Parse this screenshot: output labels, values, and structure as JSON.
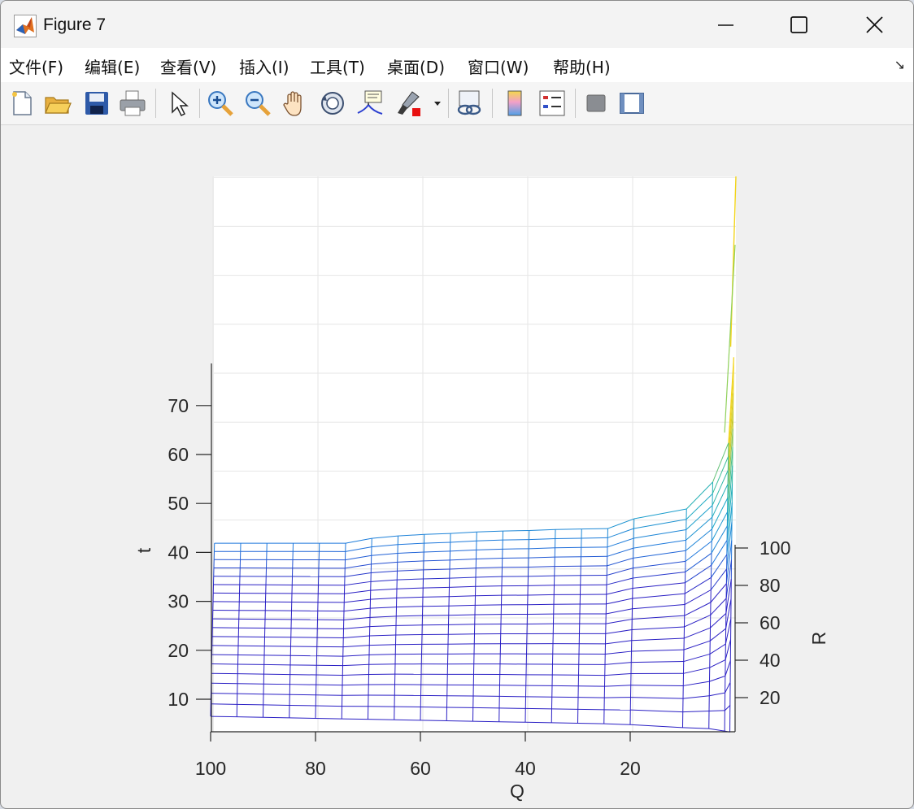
{
  "window": {
    "title": "Figure 7"
  },
  "menubar": {
    "items": [
      "文件(F)",
      "编辑(E)",
      "查看(V)",
      "插入(I)",
      "工具(T)",
      "桌面(D)",
      "窗口(W)",
      "帮助(H)"
    ],
    "dock_arrow": "↘"
  },
  "toolbar": {
    "icons": [
      "new-figure-icon",
      "open-file-icon",
      "save-icon",
      "print-icon",
      "edit-plot-arrow-icon",
      "zoom-in-icon",
      "zoom-out-icon",
      "pan-hand-icon",
      "rotate-3d-icon",
      "data-cursor-icon",
      "brush-icon",
      "brush-dropdown-icon",
      "link-plot-icon",
      "colorbar-icon",
      "legend-icon",
      "hide-plot-tools-icon",
      "show-plot-tools-icon"
    ]
  },
  "colors": {
    "mesh_low": "#2a1fc4",
    "mesh_mid": "#1aa8c8",
    "mesh_high": "#f2d41a",
    "grid": "#e6e6e6",
    "axis": "#262626"
  },
  "chart_data": {
    "type": "surface-mesh",
    "view": "3d",
    "colormap": "parula",
    "grid": true,
    "xlabel": "Q",
    "ylabel": "R",
    "zlabel": "t",
    "x_axis": {
      "label": "Q",
      "ticks": [
        100,
        80,
        60,
        40,
        20
      ],
      "range": [
        0,
        100
      ],
      "direction": "reversed"
    },
    "y_axis": {
      "label": "R",
      "ticks": [
        20,
        40,
        60,
        80,
        100
      ],
      "range": [
        0,
        110
      ]
    },
    "z_axis": {
      "label": "t",
      "ticks": [
        10,
        20,
        30,
        40,
        50,
        60,
        70
      ],
      "range": [
        3,
        80
      ]
    },
    "Q": [
      100,
      95,
      90,
      85,
      80,
      75,
      70,
      65,
      60,
      55,
      50,
      45,
      40,
      35,
      30,
      25,
      20,
      10,
      5,
      2,
      1
    ],
    "R": [
      5,
      10,
      15,
      20,
      25,
      30,
      35,
      40,
      45,
      50,
      55,
      60,
      65,
      70,
      75,
      80,
      85,
      90,
      95,
      100
    ],
    "t_at_R_max": [
      44,
      44,
      44,
      44,
      44,
      44,
      45,
      45.5,
      45.8,
      46,
      46.3,
      46.5,
      46.6,
      46.8,
      46.9,
      47,
      49,
      51,
      56.5,
      64.5,
      82
    ],
    "t_at_R_min": [
      6.5,
      6.4,
      6.3,
      6.2,
      6.1,
      6.0,
      5.9,
      5.8,
      5.7,
      5.6,
      5.5,
      5.4,
      5.3,
      5.2,
      5.1,
      5.0,
      4.8,
      4.2,
      4.0,
      3.5,
      3.3
    ]
  }
}
